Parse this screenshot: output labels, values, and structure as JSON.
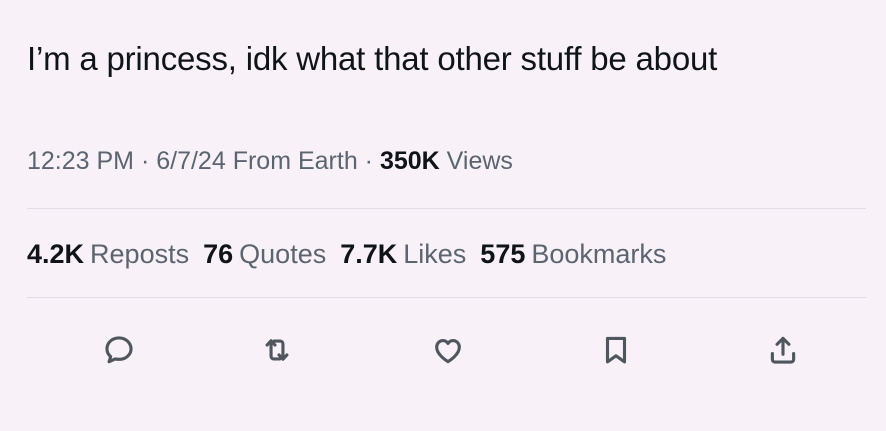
{
  "tweet": {
    "text": "I’m a princess, idk what that other stuff be about"
  },
  "meta": {
    "time": "12:23 PM",
    "sep1": " · ",
    "date": "6/7/24",
    "source": " From Earth",
    "sep2": " · ",
    "views_count": "350K",
    "views_label": " Views"
  },
  "stats": [
    {
      "count": "4.2K",
      "label": "Reposts"
    },
    {
      "count": "76",
      "label": "Quotes"
    },
    {
      "count": "7.7K",
      "label": "Likes"
    },
    {
      "count": "575",
      "label": "Bookmarks"
    }
  ],
  "actions": [
    {
      "icon": "reply-icon"
    },
    {
      "icon": "repost-icon"
    },
    {
      "icon": "like-icon"
    },
    {
      "icon": "bookmark-icon"
    },
    {
      "icon": "share-icon"
    }
  ]
}
